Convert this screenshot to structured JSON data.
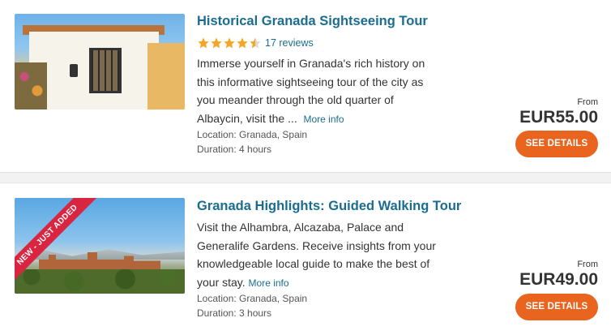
{
  "listings": [
    {
      "title": "Historical Granada Sightseeing Tour",
      "rating": 4.5,
      "reviews": "17 reviews",
      "description": "Immerse yourself in Granada's rich history on this informative sightseeing tour of the city as you meander through the old quarter of Albaycin, visit the ...",
      "more_link": "More info",
      "location": "Location: Granada, Spain",
      "duration": "Duration: 4 hours",
      "from_label": "From",
      "price": "EUR55.00",
      "button_label": "SEE DETAILS"
    },
    {
      "badge": "NEW - JUST ADDED",
      "title": "Granada Highlights: Guided Walking Tour",
      "description": "Visit the Alhambra, Alcazaba, Palace and Generalife Gardens. Receive insights from your knowledgeable local guide to make the best of your stay.",
      "more_link": "More info",
      "location": "Location: Granada, Spain",
      "duration": "Duration: 3 hours",
      "from_label": "From",
      "price": "EUR49.00",
      "button_label": "SEE DETAILS"
    }
  ],
  "colors": {
    "title_link": "#1a6d90",
    "button": "#e8641f",
    "star": "#f5a623",
    "badge": "#d9253f"
  }
}
